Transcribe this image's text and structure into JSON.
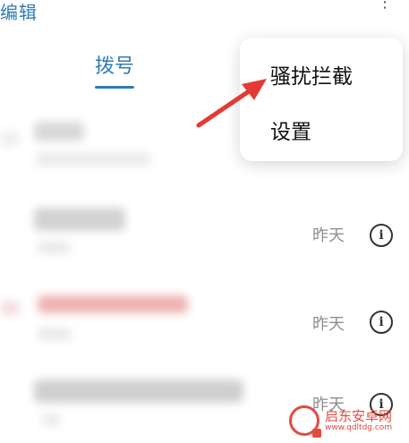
{
  "header": {
    "edit_label": "编辑",
    "more_label": "⋮"
  },
  "tabs": [
    {
      "label": "拨号",
      "active": true
    }
  ],
  "popup": {
    "items": [
      {
        "label": "骚扰拦截"
      },
      {
        "label": "设置"
      }
    ]
  },
  "calls": [
    {
      "time": ""
    },
    {
      "time": "昨天"
    },
    {
      "time": "昨天"
    },
    {
      "time": "昨天"
    }
  ],
  "watermark": {
    "name": "启东安卓网",
    "url": "www.qdltdg.com"
  },
  "colors": {
    "accent": "#2e7cb8",
    "arrow": "#e53935",
    "missed_call": "#e04b4b"
  }
}
